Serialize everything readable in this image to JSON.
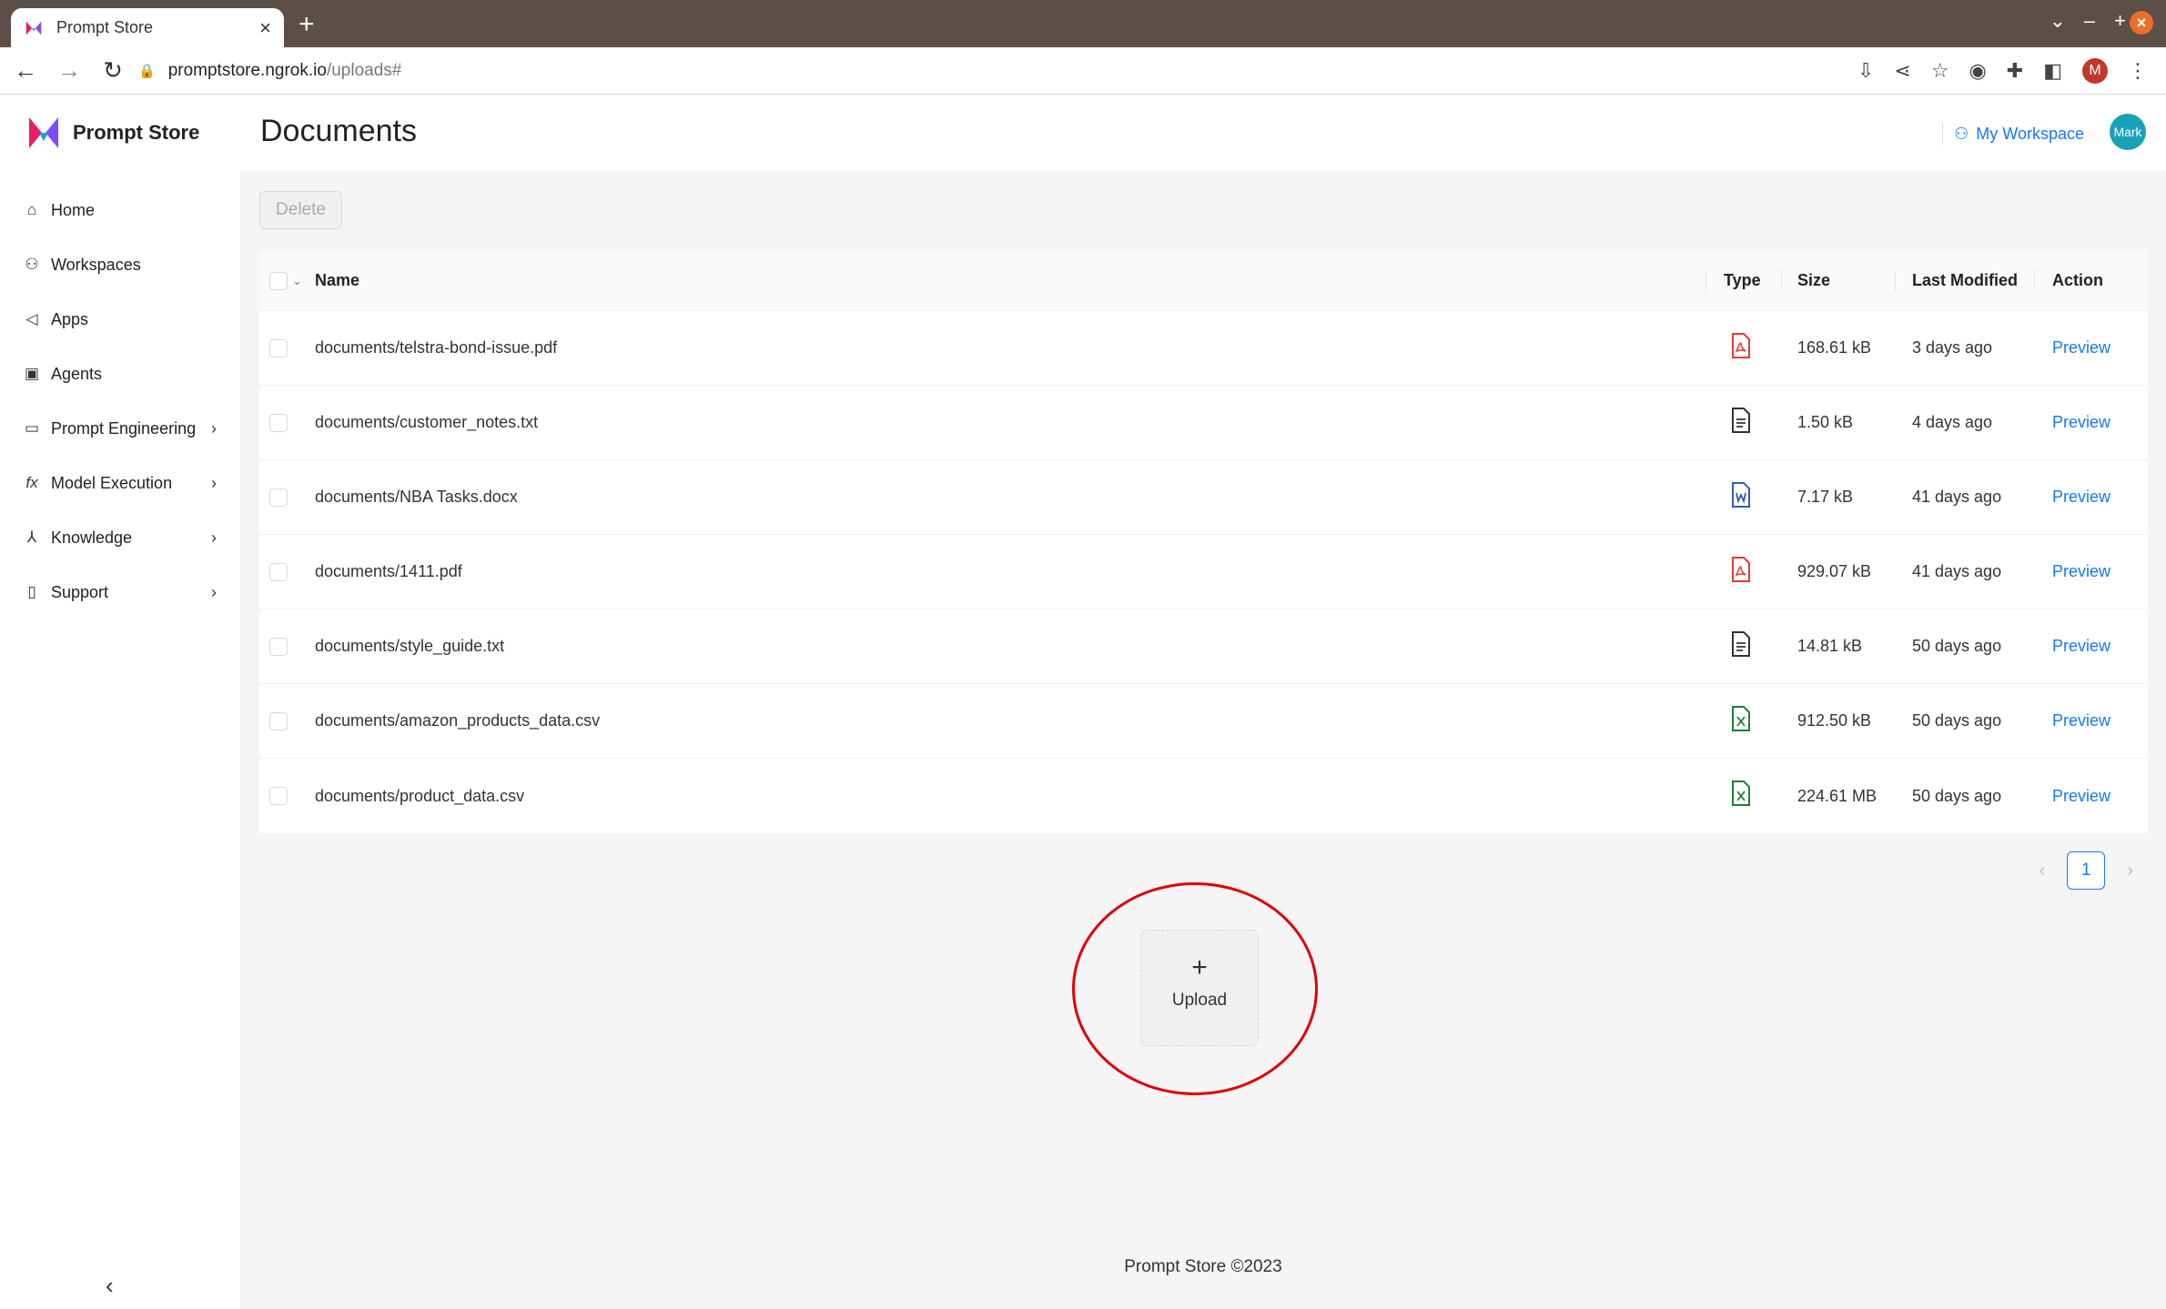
{
  "browser": {
    "tab_title": "Prompt Store",
    "url_host": "promptstore.ngrok.io",
    "url_path": "/uploads#",
    "profile_initial": "M"
  },
  "app": {
    "brand": "Prompt Store",
    "page_title": "Documents",
    "workspace_label": "My Workspace",
    "avatar_text": "Mark",
    "delete_label": "Delete",
    "footer": "Prompt Store ©2023"
  },
  "nav": [
    {
      "label": "Home",
      "icon": "home-icon",
      "expandable": false
    },
    {
      "label": "Workspaces",
      "icon": "workspaces-icon",
      "expandable": false
    },
    {
      "label": "Apps",
      "icon": "megaphone-icon",
      "expandable": false
    },
    {
      "label": "Agents",
      "icon": "agents-icon",
      "expandable": false
    },
    {
      "label": "Prompt Engineering",
      "icon": "terminal-icon",
      "expandable": true
    },
    {
      "label": "Model Execution",
      "icon": "function-icon",
      "expandable": true
    },
    {
      "label": "Knowledge",
      "icon": "network-icon",
      "expandable": true
    },
    {
      "label": "Support",
      "icon": "book-icon",
      "expandable": true
    }
  ],
  "table": {
    "columns": [
      "Name",
      "Type",
      "Size",
      "Last Modified",
      "Action"
    ],
    "rows": [
      {
        "name": "documents/telstra-bond-issue.pdf",
        "type": "pdf",
        "size": "168.61 kB",
        "modified": "3 days ago",
        "action": "Preview"
      },
      {
        "name": "documents/customer_notes.txt",
        "type": "txt",
        "size": "1.50 kB",
        "modified": "4 days ago",
        "action": "Preview"
      },
      {
        "name": "documents/NBA Tasks.docx",
        "type": "docx",
        "size": "7.17 kB",
        "modified": "41 days ago",
        "action": "Preview"
      },
      {
        "name": "documents/1411.pdf",
        "type": "pdf",
        "size": "929.07 kB",
        "modified": "41 days ago",
        "action": "Preview"
      },
      {
        "name": "documents/style_guide.txt",
        "type": "txt",
        "size": "14.81 kB",
        "modified": "50 days ago",
        "action": "Preview"
      },
      {
        "name": "documents/amazon_products_data.csv",
        "type": "csv",
        "size": "912.50 kB",
        "modified": "50 days ago",
        "action": "Preview"
      },
      {
        "name": "documents/product_data.csv",
        "type": "csv",
        "size": "224.61 MB",
        "modified": "50 days ago",
        "action": "Preview"
      }
    ]
  },
  "pagination": {
    "current": "1"
  },
  "upload": {
    "plus": "+",
    "label": "Upload"
  },
  "colors": {
    "accent": "#1677ff",
    "pdf": "#e53935",
    "docx": "#2f5fb3",
    "csv": "#1e7d3a",
    "txt": "#333333",
    "annotation": "#e00000"
  }
}
